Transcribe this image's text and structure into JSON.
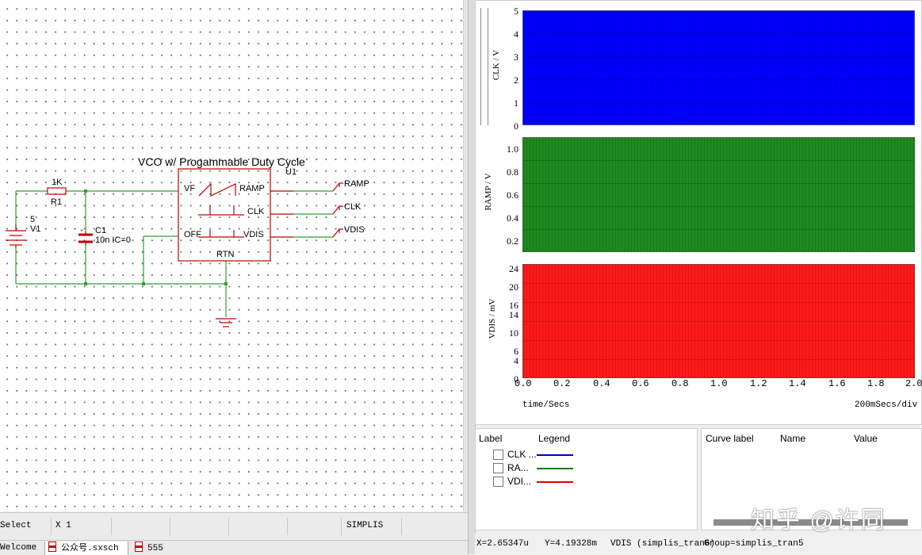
{
  "schematic": {
    "title": "VCO w/ Progammable Duty Cycle",
    "ref": "U1",
    "pins": {
      "vf": "VF",
      "off": "OFF",
      "ramp": "RAMP",
      "clk": "CLK",
      "vdis": "VDIS",
      "rtn": "RTN"
    },
    "r1": {
      "value": "1K",
      "name": "R1"
    },
    "v1": {
      "value": "5",
      "name": "V1"
    },
    "c1": {
      "name": "C1",
      "value": "10n IC=0"
    },
    "probes": [
      "RAMP",
      "CLK",
      "VDIS"
    ]
  },
  "status_bar": {
    "mode": "Select",
    "zoom": "X 1",
    "simulator": "SIMPLIS"
  },
  "tabs": [
    {
      "label": "Welcome"
    },
    {
      "label": "公众号.sxsch"
    },
    {
      "label": "555"
    }
  ],
  "waveform": {
    "plots": [
      {
        "ylabel": "CLK / V",
        "ticks": [
          "5",
          "4",
          "3",
          "2",
          "1",
          "0"
        ],
        "color": "#0000ff"
      },
      {
        "ylabel": "RAMP / V",
        "ticks": [
          "1.0",
          "0.8",
          "0.6",
          "0.4",
          "0.2"
        ],
        "color": "#008000"
      },
      {
        "ylabel": "VDIS / mV",
        "ticks": [
          "24",
          "20",
          "16",
          "14",
          "10",
          "6",
          "4",
          "0"
        ],
        "color": "#ff0000"
      }
    ],
    "xticks": [
      "0.0",
      "0.2",
      "0.4",
      "0.6",
      "0.8",
      "1.0",
      "1.2",
      "1.4",
      "1.6",
      "1.8",
      "2.0"
    ],
    "xlabel": "time/Secs",
    "xdiv": "200mSecs/div"
  },
  "legend": {
    "header_label": "Label",
    "header_legend": "Legend",
    "rows": [
      {
        "label": "CLK ...",
        "color": "#0000c8"
      },
      {
        "label": "RA...",
        "color": "#008000"
      },
      {
        "label": "VDI...",
        "color": "#e00000"
      }
    ]
  },
  "curve_panel": {
    "col_label": "Curve label",
    "col_name": "Name",
    "col_value": "Value"
  },
  "wave_status": {
    "x": "X=2.65347u",
    "y": "Y=4.19328m",
    "curve": "VDIS (simplis_tran6)",
    "group": "Group=simplis_tran5"
  },
  "watermark": "知乎 @许同"
}
